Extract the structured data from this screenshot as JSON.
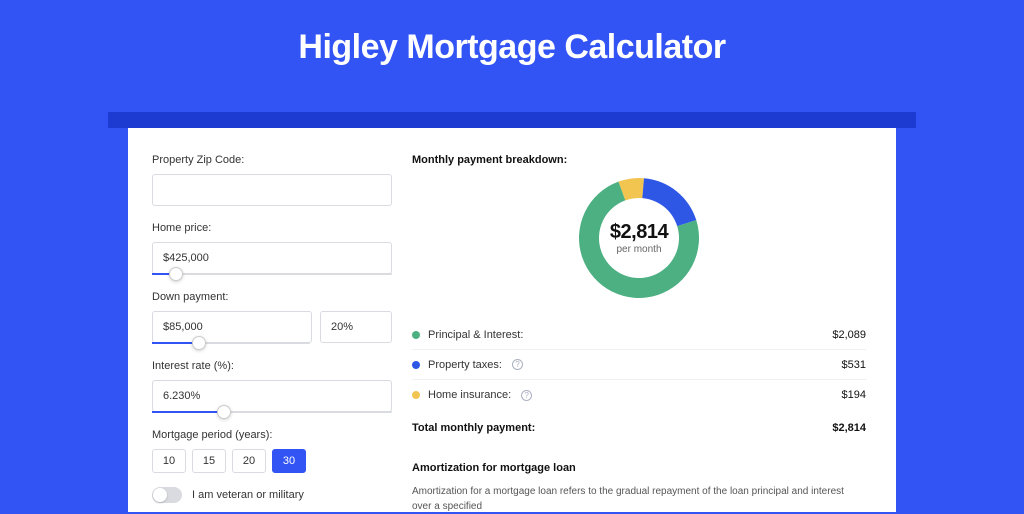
{
  "title": "Higley Mortgage Calculator",
  "form": {
    "zip_label": "Property Zip Code:",
    "zip_value": "",
    "price_label": "Home price:",
    "price_value": "$425,000",
    "price_slider_percent": 10,
    "down_label": "Down payment:",
    "down_amount": "$85,000",
    "down_percent": "20%",
    "down_slider_percent": 20,
    "rate_label": "Interest rate (%):",
    "rate_value": "6.230%",
    "rate_slider_percent": 30,
    "period_label": "Mortgage period (years):",
    "periods": [
      "10",
      "15",
      "20",
      "30"
    ],
    "period_active_index": 3,
    "veteran_label": "I am veteran or military",
    "veteran_on": false
  },
  "breakdown": {
    "title": "Monthly payment breakdown:",
    "center_amount": "$2,814",
    "center_sub": "per month",
    "items": [
      {
        "label": "Principal & Interest:",
        "value": "$2,089",
        "color": "green",
        "info": false
      },
      {
        "label": "Property taxes:",
        "value": "$531",
        "color": "blue",
        "info": true
      },
      {
        "label": "Home insurance:",
        "value": "$194",
        "color": "yellow",
        "info": true
      }
    ],
    "total_label": "Total monthly payment:",
    "total_value": "$2,814"
  },
  "amortization": {
    "title": "Amortization for mortgage loan",
    "text": "Amortization for a mortgage loan refers to the gradual repayment of the loan principal and interest over a specified"
  },
  "chart_data": {
    "type": "pie",
    "title": "Monthly payment breakdown",
    "series": [
      {
        "name": "Principal & Interest",
        "value": 2089,
        "color": "#4db082"
      },
      {
        "name": "Property taxes",
        "value": 531,
        "color": "#2f57e6"
      },
      {
        "name": "Home insurance",
        "value": 194,
        "color": "#f1c550"
      }
    ],
    "total": 2814,
    "center_label": "$2,814 per month"
  }
}
